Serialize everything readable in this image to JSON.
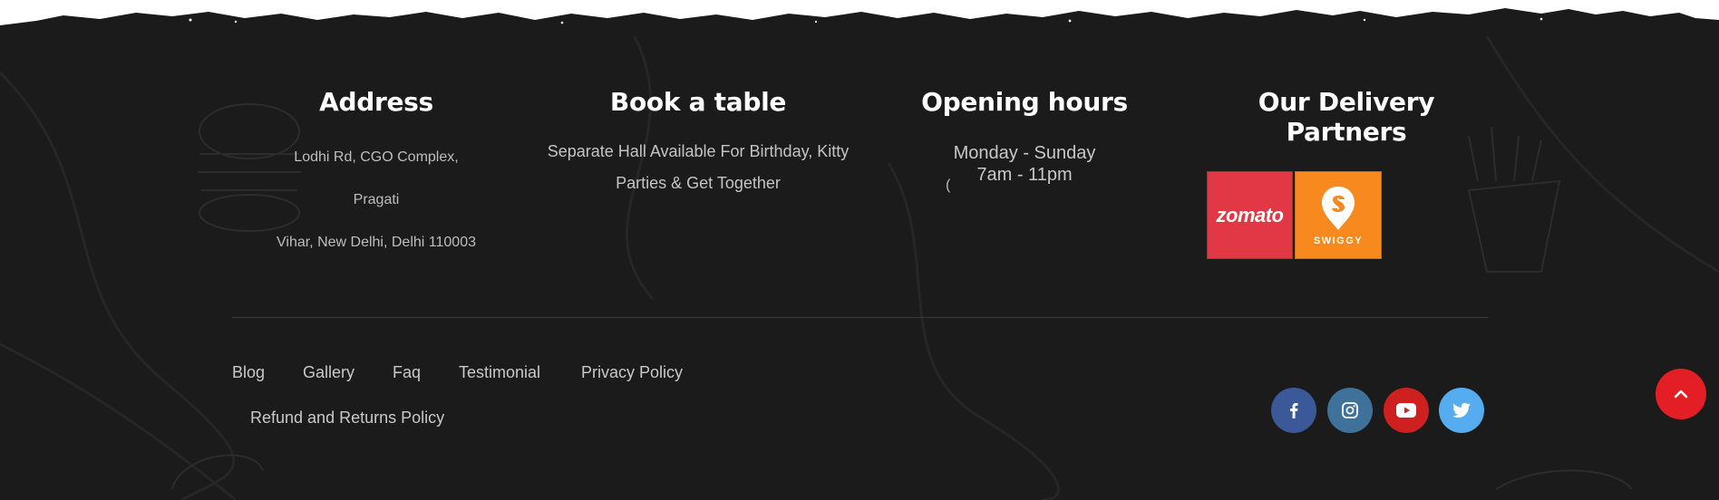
{
  "address": {
    "heading": "Address",
    "line1": "Lodhi Rd, CGO Complex, Pragati",
    "line2": "Vihar, New Delhi, Delhi 110003"
  },
  "book_table": {
    "heading": "Book a table",
    "description": "Separate Hall Available For Birthday, Kitty Parties & Get Together"
  },
  "opening_hours": {
    "heading": "Opening hours",
    "days": "Monday - Sunday",
    "time": "7am - 11pm",
    "stray_char": "("
  },
  "delivery_partners": {
    "heading": "Our Delivery Partners",
    "zomato_label": "zomato",
    "swiggy_label": "SWIGGY"
  },
  "footer_nav": {
    "blog": "Blog",
    "gallery": "Gallery",
    "faq": "Faq",
    "testimonial": "Testimonial",
    "privacy": "Privacy Policy",
    "refund": "Refund and Returns Policy"
  },
  "social": {
    "icons": [
      "facebook-icon",
      "instagram-icon",
      "youtube-icon",
      "twitter-icon"
    ],
    "colors": {
      "facebook": "#3b5998",
      "instagram": "#3f729b",
      "youtube": "#cd201f",
      "twitter": "#55acee"
    }
  },
  "scroll_top": {
    "icon": "chevron-up-icon",
    "color": "#e31e24"
  },
  "theme": {
    "background": "#1b1b1b",
    "heading": "#ffffff",
    "text": "#c4c4c4"
  }
}
